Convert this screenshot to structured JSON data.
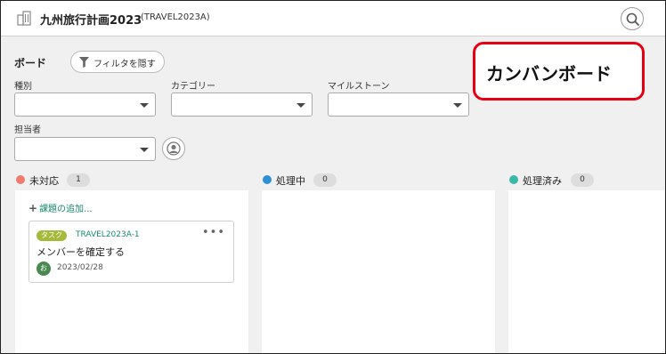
{
  "header": {
    "project_name": "九州旅行計画2023",
    "project_key": "(TRAVEL2023A)"
  },
  "board": {
    "title": "ボード",
    "filter_button": "フィルタを隠す",
    "filters": {
      "type_label": "種別",
      "category_label": "カテゴリー",
      "milestone_label": "マイルストーン",
      "assignee_label": "担当者"
    }
  },
  "callout": {
    "text": "カンバンボード",
    "color": "#e60012"
  },
  "columns": [
    {
      "name": "未対応",
      "count": "1",
      "color": "#ef7a6f"
    },
    {
      "name": "処理中",
      "count": "0",
      "color": "#2d8fd4"
    },
    {
      "name": "処理済み",
      "count": "0",
      "color": "#3ab8a8"
    }
  ],
  "add_issue": "課題の追加...",
  "card": {
    "tag": "タスク",
    "issue_key": "TRAVEL2023A-1",
    "menu": "•••",
    "title": "メンバーを確定する",
    "avatar": "お",
    "due_date": "2023/02/28",
    "tag_color": "#a4bb3a"
  }
}
